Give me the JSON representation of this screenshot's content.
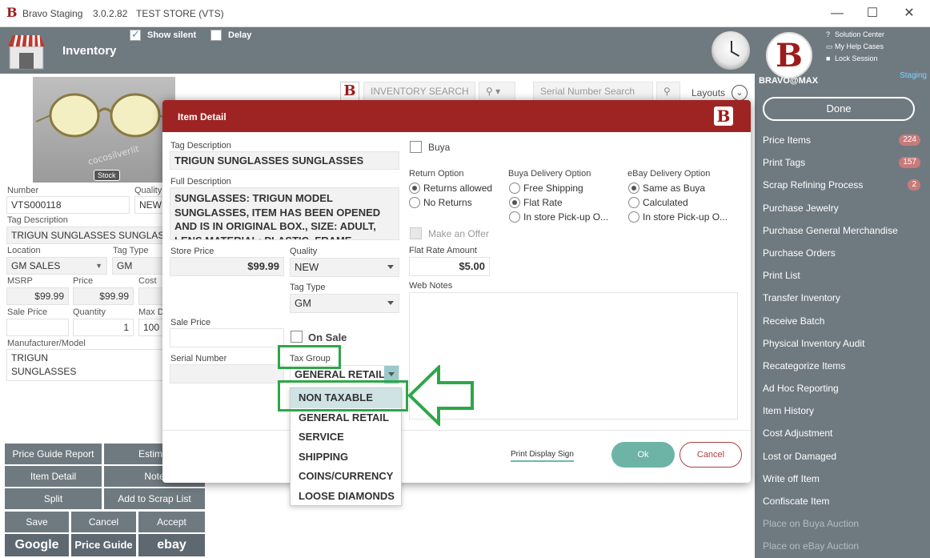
{
  "window": {
    "app_name": "Bravo Staging",
    "version": "3.0.2.82",
    "store": "TEST STORE (VTS)",
    "minimize": "—",
    "maximize": "☐",
    "close": "✕"
  },
  "topbar": {
    "title": "Inventory",
    "show_silent_label": "Show silent",
    "show_silent_checked": true,
    "delay_label": "Delay"
  },
  "user_panel": {
    "help_links": [
      "Solution Center",
      "My Help Cases",
      "Lock Session"
    ],
    "username": "BRAVO@MAX",
    "env": "Staging",
    "done_label": "Done"
  },
  "menu": [
    {
      "label": "Price Items",
      "badge": "224"
    },
    {
      "label": "Print Tags",
      "badge": "157"
    },
    {
      "label": "Scrap Refining Process",
      "badge": "2"
    },
    {
      "label": "Purchase Jewelry"
    },
    {
      "label": "Purchase General Merchandise"
    },
    {
      "label": "Purchase Orders"
    },
    {
      "label": "Print List"
    },
    {
      "label": "Transfer Inventory"
    },
    {
      "label": "Receive Batch"
    },
    {
      "label": "Physical Inventory Audit"
    },
    {
      "label": "Recategorize Items"
    },
    {
      "label": "Ad Hoc Reporting"
    },
    {
      "label": "Item History"
    },
    {
      "label": "Cost Adjustment"
    },
    {
      "label": "Lost or Damaged"
    },
    {
      "label": "Write off Item"
    },
    {
      "label": "Confiscate Item"
    },
    {
      "label": "Place on Buya Auction",
      "disabled": true
    },
    {
      "label": "Place on eBay Auction",
      "disabled": true
    }
  ],
  "left": {
    "image_watermark": "cocosilverlit",
    "stock_tag": "Stock",
    "number_label": "Number",
    "number_value": "VTS000118",
    "quality_label": "Quality",
    "quality_value": "NEW",
    "tag_desc_label": "Tag Description",
    "tag_desc_value": "TRIGUN SUNGLASSES SUNGLASSES",
    "location_label": "Location",
    "location_value": "GM SALES",
    "tag_type_label": "Tag Type",
    "tag_type_value": "GM",
    "msrp_label": "MSRP",
    "msrp_value": "$99.99",
    "price_label": "Price",
    "price_value": "$99.99",
    "cost_label": "Cost",
    "sale_price_label": "Sale Price",
    "quantity_label": "Quantity",
    "quantity_value": "1",
    "max_label": "Max D",
    "max_value": "100",
    "manufacturer_label": "Manufacturer/Model",
    "manufacturer_line1": "TRIGUN",
    "manufacturer_line2": "SUNGLASSES"
  },
  "left_buttons": {
    "price_guide_report": "Price Guide Report",
    "estimate": "Estimat",
    "item_detail": "Item Detail",
    "notes": "Note",
    "split": "Split",
    "add_to_scrap": "Add to Scrap List",
    "save": "Save",
    "cancel": "Cancel",
    "accept": "Accept",
    "google": "Google",
    "price_guide": "Price Guide",
    "ebay": "ebay"
  },
  "search": {
    "inventory_placeholder": "INVENTORY SEARCH",
    "serial_placeholder": "Serial Number Search",
    "layouts_label": "Layouts"
  },
  "modal": {
    "title": "Item Detail",
    "tag_desc_label": "Tag Description",
    "tag_desc_value": "TRIGUN SUNGLASSES SUNGLASSES",
    "full_desc_label": "Full Description",
    "full_desc_line1": "SUNGLASSES: TRIGUN MODEL",
    "full_desc_line2": "SUNGLASSES, ITEM HAS BEEN OPENED",
    "full_desc_line3": "AND IS IN ORIGINAL BOX., SIZE: ADULT,",
    "full_desc_line4": "LENS MATERIAL: PLASTIC, FRAME",
    "store_price_label": "Store Price",
    "store_price_value": "$99.99",
    "quality_label": "Quality",
    "quality_value": "NEW",
    "tag_type_label": "Tag Type",
    "tag_type_value": "GM",
    "sale_price_label": "Sale Price",
    "on_sale_label": "On Sale",
    "serial_label": "Serial Number",
    "tax_group_label": "Tax Group",
    "tax_group_value": "GENERAL RETAIL",
    "buya_label": "Buya",
    "return_option_label": "Return Option",
    "return_options": [
      "Returns allowed",
      "No Returns"
    ],
    "buya_delivery_label": "Buya Delivery Option",
    "buya_delivery_options": [
      "Free Shipping",
      "Flat Rate",
      "In store Pick-up O..."
    ],
    "ebay_delivery_label": "eBay Delivery Option",
    "ebay_delivery_options": [
      "Same as Buya",
      "Calculated",
      "In store Pick-up O..."
    ],
    "make_offer_label": "Make an Offer",
    "flat_rate_label": "Flat Rate Amount",
    "flat_rate_value": "$5.00",
    "web_notes_label": "Web Notes",
    "print_display_sign": "Print Display Sign",
    "ok_label": "Ok",
    "cancel_label": "Cancel"
  },
  "tax_dropdown": {
    "options": [
      "NON TAXABLE",
      "GENERAL RETAIL",
      "SERVICE",
      "SHIPPING",
      "COINS/CURRENCY",
      "LOOSE DIAMONDS"
    ],
    "highlighted": "NON TAXABLE"
  },
  "colors": {
    "header_red": "#9e2424",
    "panel_gray": "#6f7a80",
    "annotation_green": "#2ea64a",
    "ok_teal": "#6db3a6"
  }
}
